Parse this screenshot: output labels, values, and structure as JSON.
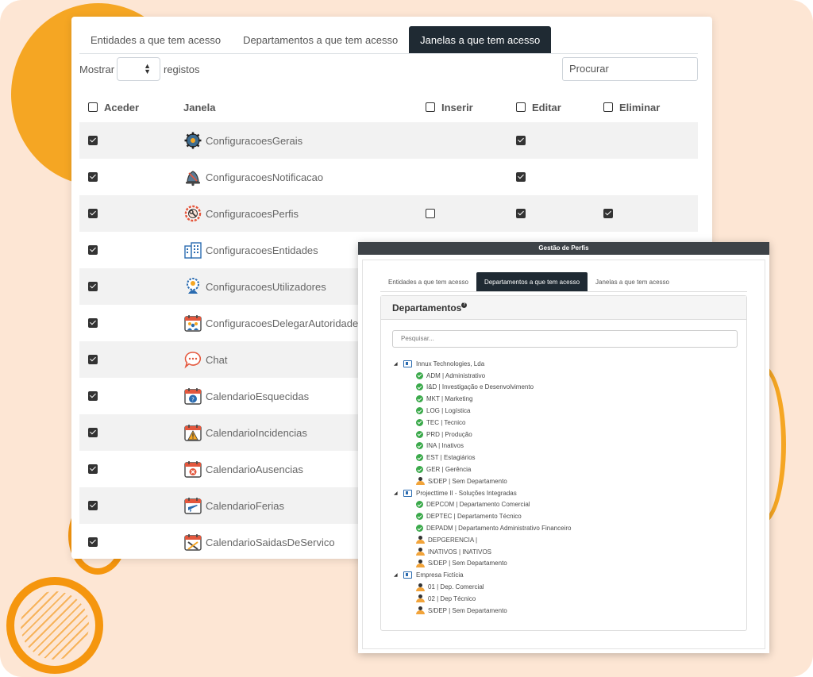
{
  "main": {
    "tabs": [
      {
        "label": "Entidades a que tem acesso",
        "active": false
      },
      {
        "label": "Departamentos a que tem acesso",
        "active": false
      },
      {
        "label": "Janelas a que tem acesso",
        "active": true
      }
    ],
    "show_label": "Mostrar",
    "registos_label": "registos",
    "search_placeholder": "Procurar",
    "columns": {
      "aceder": "Aceder",
      "janela": "Janela",
      "inserir": "Inserir",
      "editar": "Editar",
      "eliminar": "Eliminar"
    },
    "header_checks": {
      "aceder": false,
      "inserir": false,
      "editar": false,
      "eliminar": false
    },
    "rows": [
      {
        "janela": "ConfiguracoesGerais",
        "icon": "gear-icon",
        "aceder": true,
        "inserir": null,
        "editar": true,
        "eliminar": null
      },
      {
        "janela": "ConfiguracoesNotificacao",
        "icon": "bell-icon",
        "aceder": true,
        "inserir": null,
        "editar": true,
        "eliminar": null
      },
      {
        "janela": "ConfiguracoesPerfis",
        "icon": "key-gear-icon",
        "aceder": true,
        "inserir": false,
        "editar": true,
        "eliminar": true
      },
      {
        "janela": "ConfiguracoesEntidades",
        "icon": "buildings-icon",
        "aceder": true,
        "inserir": null,
        "editar": null,
        "eliminar": null
      },
      {
        "janela": "ConfiguracoesUtilizadores",
        "icon": "user-gear-icon",
        "aceder": true,
        "inserir": null,
        "editar": null,
        "eliminar": null
      },
      {
        "janela": "ConfiguracoesDelegarAutoridade",
        "icon": "group-calendar-icon",
        "aceder": true,
        "inserir": null,
        "editar": null,
        "eliminar": null
      },
      {
        "janela": "Chat",
        "icon": "chat-bubble-icon",
        "aceder": true,
        "inserir": null,
        "editar": null,
        "eliminar": null
      },
      {
        "janela": "CalendarioEsquecidas",
        "icon": "calendar-question-icon",
        "aceder": true,
        "inserir": null,
        "editar": null,
        "eliminar": null
      },
      {
        "janela": "CalendarioIncidencias",
        "icon": "calendar-warning-icon",
        "aceder": true,
        "inserir": null,
        "editar": null,
        "eliminar": null
      },
      {
        "janela": "CalendarioAusencias",
        "icon": "calendar-x-icon",
        "aceder": true,
        "inserir": null,
        "editar": null,
        "eliminar": null
      },
      {
        "janela": "CalendarioFerias",
        "icon": "calendar-plane-icon",
        "aceder": true,
        "inserir": null,
        "editar": null,
        "eliminar": null
      },
      {
        "janela": "CalendarioSaidasDeServico",
        "icon": "calendar-tools-icon",
        "aceder": true,
        "inserir": null,
        "editar": null,
        "eliminar": null
      }
    ]
  },
  "perfis": {
    "title": "Gestão de Perfis",
    "tabs": [
      {
        "label": "Entidades a que tem acesso",
        "active": false
      },
      {
        "label": "Departamentos a que tem acesso",
        "active": true
      },
      {
        "label": "Janelas a que tem acesso",
        "active": false
      }
    ],
    "panel_title": "Departamentos",
    "help_glyph": "?",
    "search_placeholder": "Pesquisar...",
    "tree": [
      {
        "level": 0,
        "icon": "company-icon",
        "label": "Innux Technologies, Lda"
      },
      {
        "level": 1,
        "icon": "check-circle-icon",
        "label": "ADM | Administrativo"
      },
      {
        "level": 1,
        "icon": "check-circle-icon",
        "label": "I&D | Investigação e Desenvolvimento"
      },
      {
        "level": 1,
        "icon": "check-circle-icon",
        "label": "MKT | Marketing"
      },
      {
        "level": 1,
        "icon": "check-circle-icon",
        "label": "LOG | Logística"
      },
      {
        "level": 1,
        "icon": "check-circle-icon",
        "label": "TEC | Tecnico"
      },
      {
        "level": 1,
        "icon": "check-circle-icon",
        "label": "PRD | Produção"
      },
      {
        "level": 1,
        "icon": "check-circle-icon",
        "label": "INA | Inativos"
      },
      {
        "level": 1,
        "icon": "check-circle-icon",
        "label": "EST | Estagiários"
      },
      {
        "level": 1,
        "icon": "check-circle-icon",
        "label": "GER | Gerência"
      },
      {
        "level": 1,
        "icon": "people-icon",
        "label": "S/DEP | Sem Departamento"
      },
      {
        "level": 0,
        "icon": "company-icon",
        "label": "Projecttime II - Soluções Integradas"
      },
      {
        "level": 1,
        "icon": "check-circle-icon",
        "label": "DEPCOM | Departamento Comercial"
      },
      {
        "level": 1,
        "icon": "check-circle-icon",
        "label": "DEPTEC | Departamento Técnico"
      },
      {
        "level": 1,
        "icon": "check-circle-icon",
        "label": "DEPADM | Departamento Administrativo Financeiro"
      },
      {
        "level": 1,
        "icon": "people-icon",
        "label": "DEPGERENCIA |"
      },
      {
        "level": 1,
        "icon": "people-icon",
        "label": "INATIVOS | INATIVOS"
      },
      {
        "level": 1,
        "icon": "people-icon",
        "label": "S/DEP | Sem Departamento"
      },
      {
        "level": 0,
        "icon": "company-icon",
        "label": "Empresa Fictícia"
      },
      {
        "level": 1,
        "icon": "people-icon",
        "label": "01 | Dep. Comercial"
      },
      {
        "level": 1,
        "icon": "people-icon",
        "label": "02 | Dep Técnico"
      },
      {
        "level": 1,
        "icon": "people-icon",
        "label": "S/DEP | Sem Departamento"
      }
    ]
  },
  "colors": {
    "accent": "#f5a623",
    "background": "#fde6d4",
    "tab_active": "#1f2a33",
    "check_green": "#3aa94a"
  }
}
